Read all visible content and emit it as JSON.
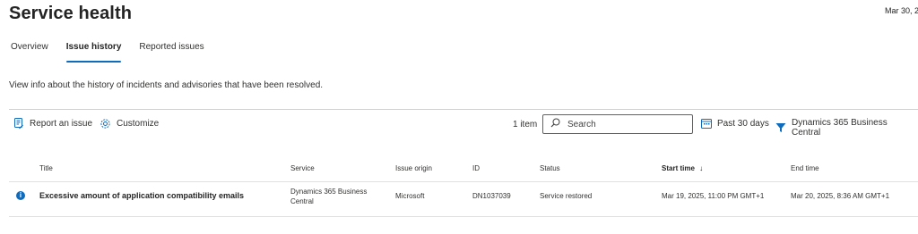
{
  "header": {
    "title": "Service health",
    "date": "Mar 30, 2"
  },
  "tabs": [
    {
      "label": "Overview"
    },
    {
      "label": "Issue history"
    },
    {
      "label": "Reported issues"
    }
  ],
  "description": "View info about the history of incidents and advisories that have been resolved.",
  "toolbar": {
    "report_label": "Report an issue",
    "customize_label": "Customize",
    "item_count": "1 item",
    "search_placeholder": "Search",
    "date_filter": "Past 30 days",
    "service_filter": "Dynamics 365 Business Central"
  },
  "table": {
    "columns": {
      "title": "Title",
      "service": "Service",
      "origin": "Issue origin",
      "id": "ID",
      "status": "Status",
      "start": "Start time",
      "sort_arrow": "↓",
      "end": "End time"
    },
    "rows": [
      {
        "title": "Excessive amount of application compatibility emails",
        "service_line1": "Dynamics 365 Business",
        "service_line2": "Central",
        "origin": "Microsoft",
        "id": "DN1037039",
        "status": "Service restored",
        "start": "Mar 19, 2025, 11:00 PM GMT+1",
        "end": "Mar 20, 2025, 8:36 AM GMT+1"
      }
    ]
  },
  "colors": {
    "accent": "#0f6cbd"
  }
}
